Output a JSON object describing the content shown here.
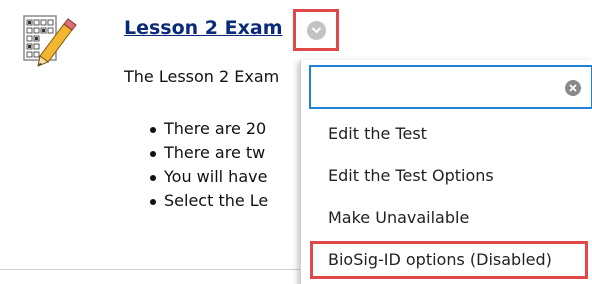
{
  "item": {
    "title": "Lesson 2 Exam",
    "description": "The Lesson 2 Exam",
    "bullets": [
      "There are 20",
      "There are tw",
      "You will have",
      "Select the Le"
    ]
  },
  "menu": {
    "search": {
      "value": "",
      "placeholder": ""
    },
    "items": [
      "Edit the Test",
      "Edit the Test Options",
      "Make Unavailable",
      "BioSig-ID options (Disabled)"
    ]
  },
  "colors": {
    "title": "#0c2a7a",
    "highlight_border": "#e24848",
    "search_border": "#1f82d4"
  },
  "icons": {
    "item": "test-pencil-icon",
    "menu_trigger": "chevron-down-circle-icon",
    "clear": "clear-circle-icon"
  }
}
